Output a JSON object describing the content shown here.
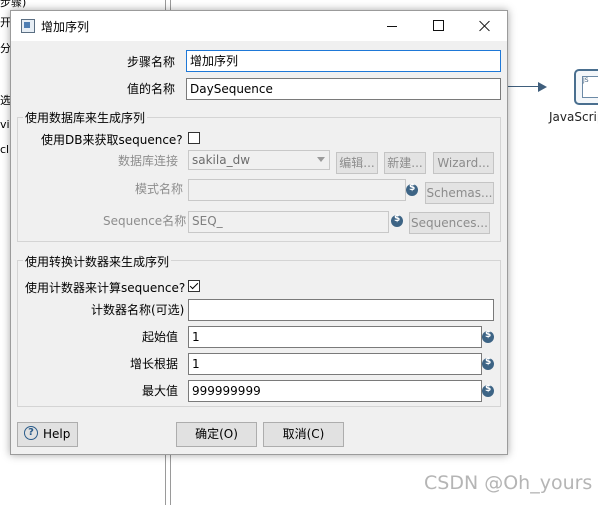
{
  "background": {
    "left_fragments": [
      "步骤)",
      "开始",
      "分区字段",
      "选择s",
      "vice",
      "cl"
    ],
    "js_step_label": "JavaScript",
    "watermark": "CSDN @Oh_yours"
  },
  "dialog": {
    "title": "增加序列",
    "step_name_label": "步骤名称",
    "step_name_value": "增加序列",
    "value_name_label": "值的名称",
    "value_name_value": "DaySequence",
    "db_group": {
      "title": "使用数据库来生成序列",
      "use_db_label": "使用DB来获取sequence?",
      "use_db_checked": false,
      "connection_label": "数据库连接",
      "connection_value": "sakila_dw",
      "edit_button": "编辑...",
      "new_button": "新建...",
      "wizard_button": "Wizard...",
      "schema_label": "模式名称",
      "schema_value": "",
      "schemas_button": "Schemas...",
      "sequence_label": "Sequence名称",
      "sequence_value": "SEQ_",
      "sequences_button": "Sequences..."
    },
    "counter_group": {
      "title": "使用转换计数器来生成序列",
      "use_counter_label": "使用计数器来计算sequence?",
      "use_counter_checked": true,
      "counter_name_label": "计数器名称(可选)",
      "counter_name_value": "",
      "start_label": "起始值",
      "start_value": "1",
      "increment_label": "增长根据",
      "increment_value": "1",
      "max_label": "最大值",
      "max_value": "999999999"
    },
    "help_button": "Help",
    "ok_button": "确定(O)",
    "cancel_button": "取消(C)"
  }
}
